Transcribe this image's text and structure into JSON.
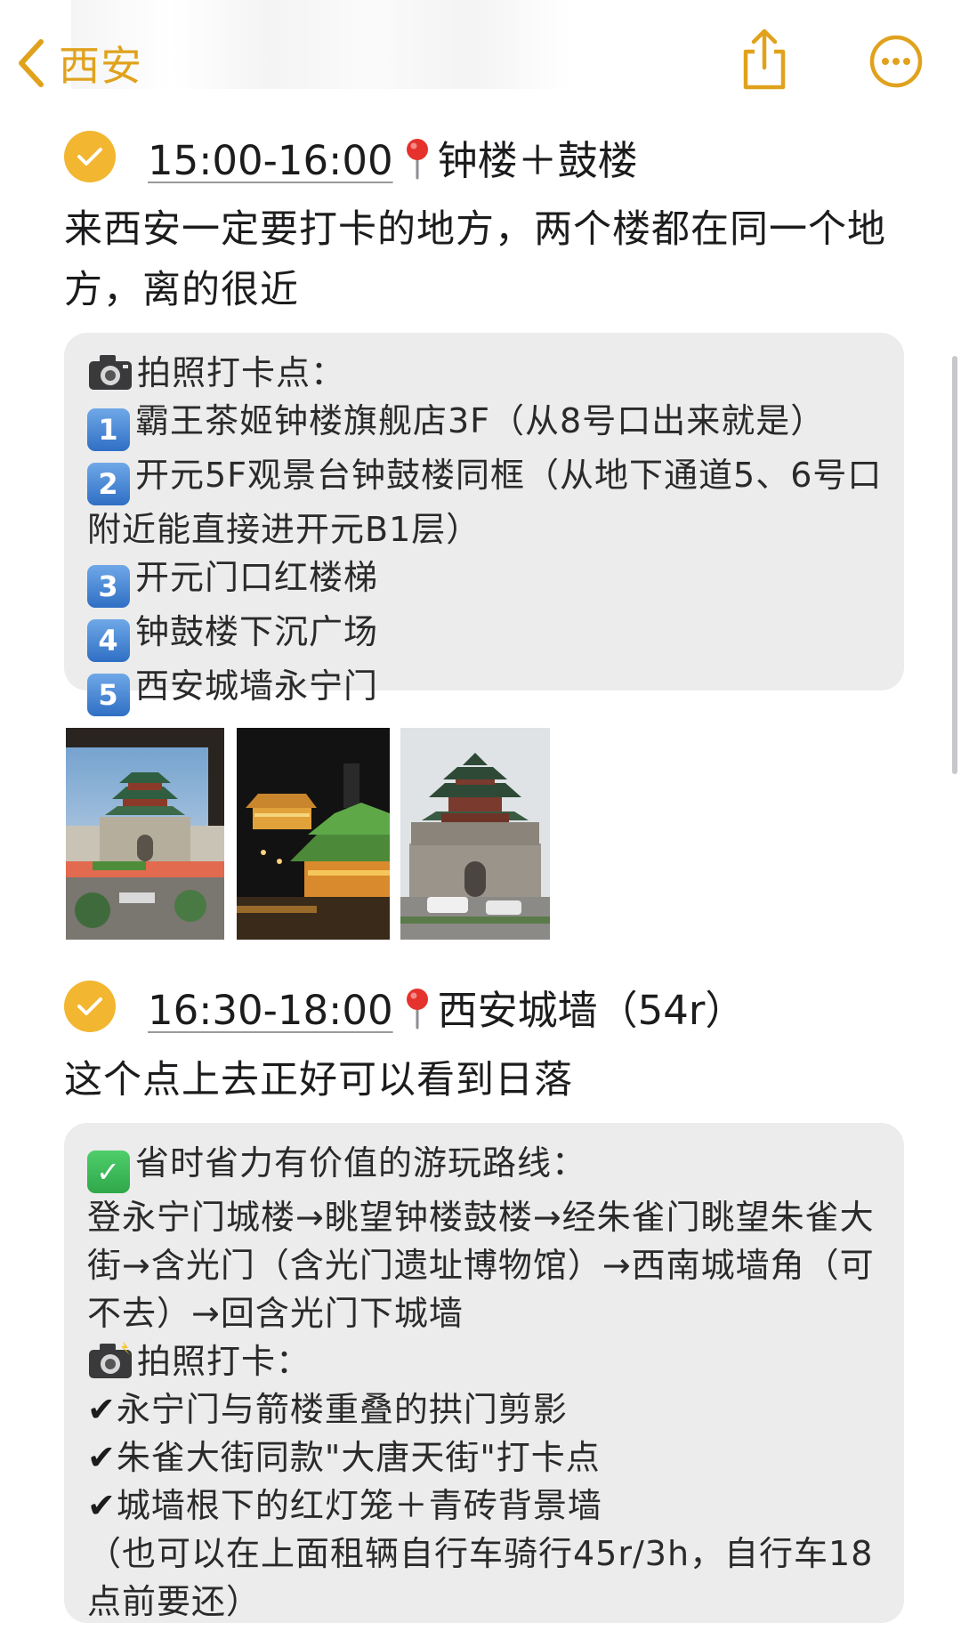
{
  "nav": {
    "back_label": "西安",
    "accent": "#e0a21d"
  },
  "tasks": [
    {
      "time": "15:00-16:00",
      "place": "钟楼＋鼓楼",
      "description": "来西安一定要打卡的地方，两个楼都在同一个地方，离的很近",
      "card": {
        "heading": "拍照打卡点：",
        "items": [
          {
            "num": "1",
            "text": "霸王茶姬钟楼旗舰店3F（从8号口出来就是）"
          },
          {
            "num": "2",
            "text": "开元5F观景台钟鼓楼同框（从地下通道5、6号口附近能直接进开元B1层）"
          },
          {
            "num": "3",
            "text": "开元门口红楼梯"
          },
          {
            "num": "4",
            "text": "钟鼓楼下沉广场"
          },
          {
            "num": "5",
            "text": "西安城墙永宁门"
          }
        ]
      }
    },
    {
      "time": "16:30-18:00",
      "place": "西安城墙（54r）",
      "description": "这个点上去正好可以看到日落",
      "card": {
        "route_heading": "省时省力有价值的游玩路线：",
        "route_text": "登永宁门城楼→眺望钟楼鼓楼→经朱雀门眺望朱雀大街→含光门（含光门遗址博物馆）→西南城墙角（可不去）→回含光门下城墙",
        "photo_heading": "拍照打卡：",
        "photo_items": [
          "永宁门与箭楼重叠的拱门剪影",
          "朱雀大街同款\"大唐天街\"打卡点",
          "城墙根下的红灯笼＋青砖背景墙"
        ],
        "note": "（也可以在上面租辆自行车骑行45r/3h，自行车18点前要还）"
      }
    }
  ],
  "icons": {
    "back": "chevron-left-icon",
    "share": "share-icon",
    "more": "ellipsis-circle-icon",
    "check": "checkmark-circle-icon",
    "pin": "round-pushpin-icon",
    "camera": "camera-icon"
  },
  "colors": {
    "check_fill": "#f2b630",
    "card_bg": "#ececec",
    "keycap": "#2f6fc4"
  }
}
